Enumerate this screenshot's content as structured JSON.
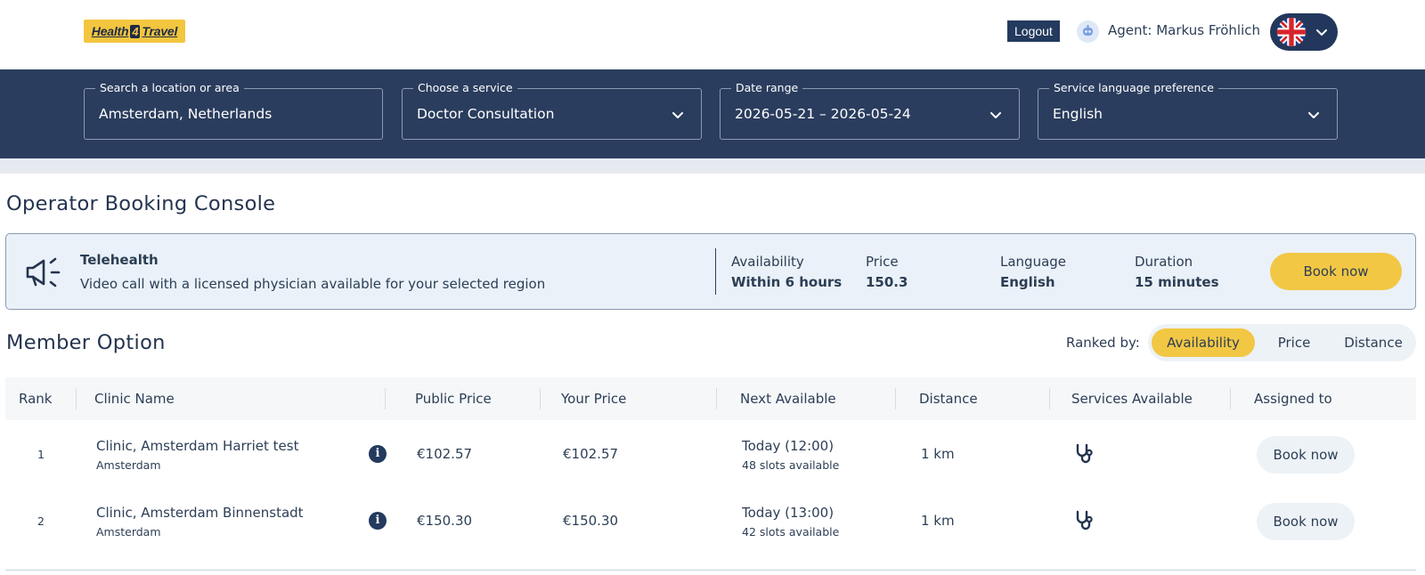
{
  "header": {
    "logo_text_a": "Health",
    "logo_text_b": "4",
    "logo_text_c": "Travel",
    "logout_label": "Logout",
    "agent_label": "Agent: Markus Fröhlich",
    "language_flag": "uk-flag-icon"
  },
  "search": {
    "location": {
      "label": "Search a location or area",
      "value": "Amsterdam, Netherlands"
    },
    "service": {
      "label": "Choose a service",
      "value": "Doctor Consultation"
    },
    "dates": {
      "label": "Date range",
      "value": "2026-05-21 – 2026-05-24"
    },
    "language": {
      "label": "Service language preference",
      "value": "English"
    }
  },
  "page_title": "Operator Booking Console",
  "telehealth": {
    "title": "Telehealth",
    "description": "Video call with a licensed physician available for your selected region",
    "availability_label": "Availability",
    "availability_value": "Within 6 hours",
    "price_label": "Price",
    "price_value": "150.3",
    "language_label": "Language",
    "language_value": "English",
    "duration_label": "Duration",
    "duration_value": "15 minutes",
    "book_label": "Book now"
  },
  "member": {
    "title": "Member Option",
    "ranked_by_label": "Ranked by:",
    "ranking_options": [
      "Availability",
      "Price",
      "Distance"
    ],
    "active_ranking": "Availability"
  },
  "table": {
    "columns": [
      "Rank",
      "Clinic Name",
      "Public Price",
      "Your Price",
      "Next Available",
      "Distance",
      "Services Available",
      "Assigned to"
    ],
    "rows": [
      {
        "rank": "1",
        "clinic": "Clinic, Amsterdam Harriet test",
        "city": "Amsterdam",
        "public_price": "€102.57",
        "your_price": "€102.57",
        "next_available": "Today (12:00)",
        "slots": "48 slots available",
        "distance": "1 km",
        "service_icon": "stethoscope-icon",
        "book_label": "Book now"
      },
      {
        "rank": "2",
        "clinic": "Clinic, Amsterdam Binnenstadt",
        "city": "Amsterdam",
        "public_price": "€150.30",
        "your_price": "€150.30",
        "next_available": "Today (13:00)",
        "slots": "42 slots available",
        "distance": "1 km",
        "service_icon": "stethoscope-icon",
        "book_label": "Book now"
      }
    ]
  },
  "colors": {
    "navy": "#2b3d5e",
    "accent_yellow": "#f2c744",
    "card_bg": "#eaf1f8"
  }
}
